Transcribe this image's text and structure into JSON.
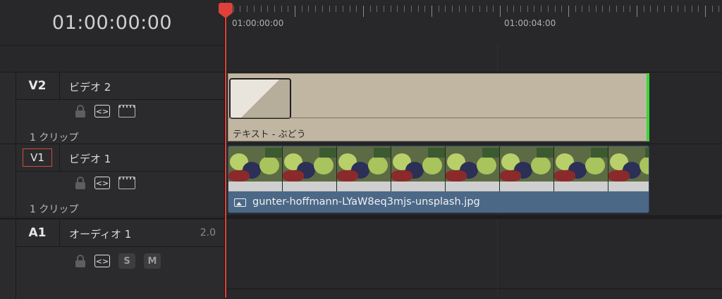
{
  "timecode": "01:00:00:00",
  "ruler": {
    "labels": [
      "01:00:00:00",
      "01:00:04:00"
    ]
  },
  "tracks": [
    {
      "id": "V2",
      "name": "ビデオ 2",
      "clips_label": "1 クリップ",
      "icons": [
        "lock-icon",
        "auto-select-icon",
        "filmstrip-icon"
      ]
    },
    {
      "id": "V1",
      "name": "ビデオ 1",
      "clips_label": "1 クリップ",
      "icons": [
        "lock-icon",
        "auto-select-icon",
        "filmstrip-icon"
      ]
    },
    {
      "id": "A1",
      "name": "オーディオ 1",
      "volume": "2.0",
      "solo": "S",
      "mute": "M",
      "icons": [
        "lock-icon",
        "auto-select-icon"
      ]
    }
  ],
  "clips": {
    "text_clip": {
      "label": "テキスト - ぶどう",
      "color": "#c0b6a2"
    },
    "image_clip": {
      "label": "gunter-hoffmann-LYaW8eq3mjs-unsplash.jpg",
      "color": "#4b6887",
      "icon": "image-icon"
    }
  },
  "colors": {
    "playhead": "#e0403a",
    "end_marker": "#3bd43b",
    "v1_highlight": "#d24a3b"
  },
  "auto_select_glyph": "<>"
}
